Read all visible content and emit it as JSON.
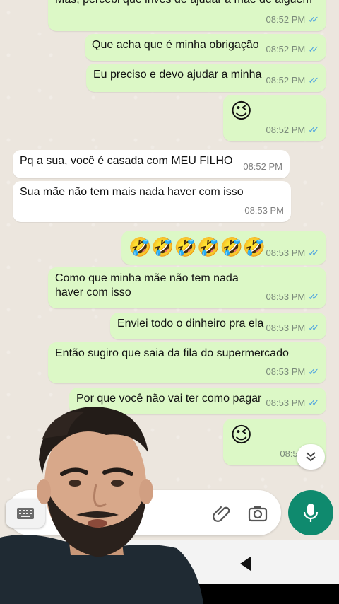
{
  "chat": {
    "messages": [
      {
        "text": "Mas, percebi que inves de ajudar a mãe de alguém",
        "time": "08:52 PM",
        "side": "out"
      },
      {
        "text": "Que acha que é minha obrigação",
        "time": "08:52 PM",
        "side": "out"
      },
      {
        "text": "Eu preciso e devo ajudar a minha",
        "time": "08:52 PM",
        "side": "out"
      },
      {
        "text": "😉",
        "time": "08:52 PM",
        "side": "out"
      },
      {
        "text": "Pq a sua, você é casada com MEU FILHO",
        "time": "08:52 PM",
        "side": "in"
      },
      {
        "text": "Sua mãe não tem mais nada haver com isso",
        "time": "08:53 PM",
        "side": "in"
      },
      {
        "text": "🤣🤣🤣🤣🤣🤣",
        "time": "08:53 PM",
        "side": "out"
      },
      {
        "text": "Como que minha mãe não tem nada haver com isso",
        "time": "08:53 PM",
        "side": "out"
      },
      {
        "text": "Enviei todo o dinheiro pra ela",
        "time": "08:53 PM",
        "side": "out"
      },
      {
        "text": "Então sugiro que saia da fila do supermercado",
        "time": "08:53 PM",
        "side": "out"
      },
      {
        "text": "Por que você não vai ter como pagar",
        "time": "08:53 PM",
        "side": "out"
      },
      {
        "text": "😉",
        "time": "08:53 PM",
        "side": "out"
      }
    ],
    "ticks": "✓✓"
  },
  "icons": {
    "scroll": "chevron-double-down-icon",
    "keyboard": "keyboard-icon",
    "attach": "paperclip-icon",
    "camera": "camera-icon",
    "mic": "microphone-icon",
    "home": "home-circle-icon",
    "back": "back-triangle-icon"
  },
  "colors": {
    "outgoing": "#dcf8c6",
    "incoming": "#ffffff",
    "accent": "#0f8a6e",
    "ticks": "#4fa3e0"
  }
}
